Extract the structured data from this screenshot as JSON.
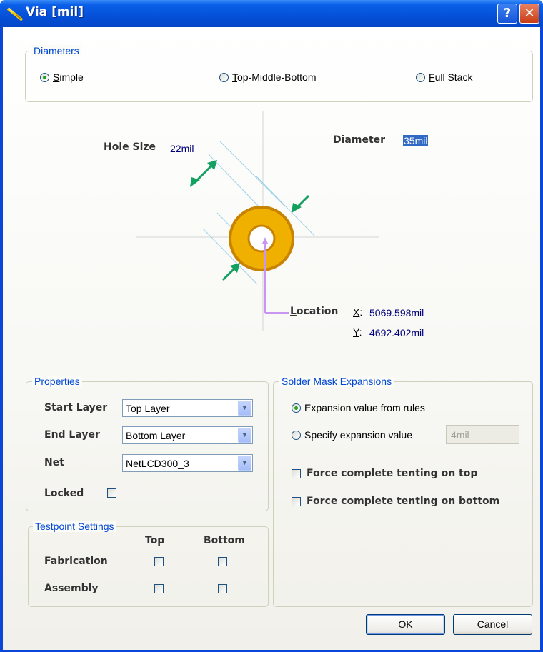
{
  "window": {
    "title": "Via [mil]",
    "help_label": "?",
    "close_label": "✕"
  },
  "diameters": {
    "legend": "Diameters",
    "options": [
      {
        "label": "Simple",
        "accel": "S",
        "rest": "imple",
        "selected": true
      },
      {
        "label": "Top-Middle-Bottom",
        "accel": "T",
        "rest": "op-Middle-Bottom",
        "selected": false
      },
      {
        "label": "Full Stack",
        "accel": "F",
        "rest": "ull Stack",
        "selected": false
      }
    ]
  },
  "diagram": {
    "hole_size_label_accel": "H",
    "hole_size_label_rest": "ole Size",
    "hole_size_value": "22mil",
    "diameter_label": "Diameter",
    "diameter_value": "35mil",
    "location_label_accel": "L",
    "location_label_rest": "ocation",
    "x_label_accel": "X",
    "x_label_rest": ":",
    "x_value": "5069.598mil",
    "y_label_accel": "Y",
    "y_label_rest": ":",
    "y_value": "4692.402mil",
    "pad_color": "#f0b000",
    "arrow_color": "#14a060",
    "location_color": "#c896f0"
  },
  "properties": {
    "legend": "Properties",
    "start_layer_label": "Start Layer",
    "start_layer_value": "Top Layer",
    "end_layer_label": "End Layer",
    "end_layer_value": "Bottom Layer",
    "net_label": "Net",
    "net_value": "NetLCD300_3",
    "locked_label": "Locked"
  },
  "testpoint": {
    "legend": "Testpoint Settings",
    "col_top": "Top",
    "col_bottom": "Bottom",
    "row_fabrication": "Fabrication",
    "row_assembly": "Assembly"
  },
  "solder_mask": {
    "legend": "Solder Mask Expansions",
    "opt_rules": "Expansion value from rules",
    "opt_specify": "Specify expansion value",
    "specify_value": "4mil",
    "tent_top": "Force complete tenting on top",
    "tent_bottom": "Force complete tenting on bottom"
  },
  "buttons": {
    "ok": "OK",
    "cancel": "Cancel"
  }
}
